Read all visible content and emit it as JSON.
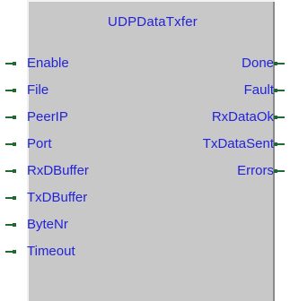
{
  "block": {
    "title": "UDPDataTxfer",
    "inputs": [
      {
        "label": "Enable"
      },
      {
        "label": "File"
      },
      {
        "label": "PeerIP"
      },
      {
        "label": "Port"
      },
      {
        "label": "RxDBuffer"
      },
      {
        "label": "TxDBuffer"
      },
      {
        "label": "ByteNr"
      },
      {
        "label": "Timeout"
      }
    ],
    "outputs": [
      {
        "label": "Done"
      },
      {
        "label": "Fault"
      },
      {
        "label": "RxDataOk"
      },
      {
        "label": "TxDataSent"
      },
      {
        "label": "Errors"
      }
    ]
  },
  "colors": {
    "block_fill": "#c8c8c8",
    "label_text": "#2222dd",
    "connector": "#1f6a30"
  }
}
